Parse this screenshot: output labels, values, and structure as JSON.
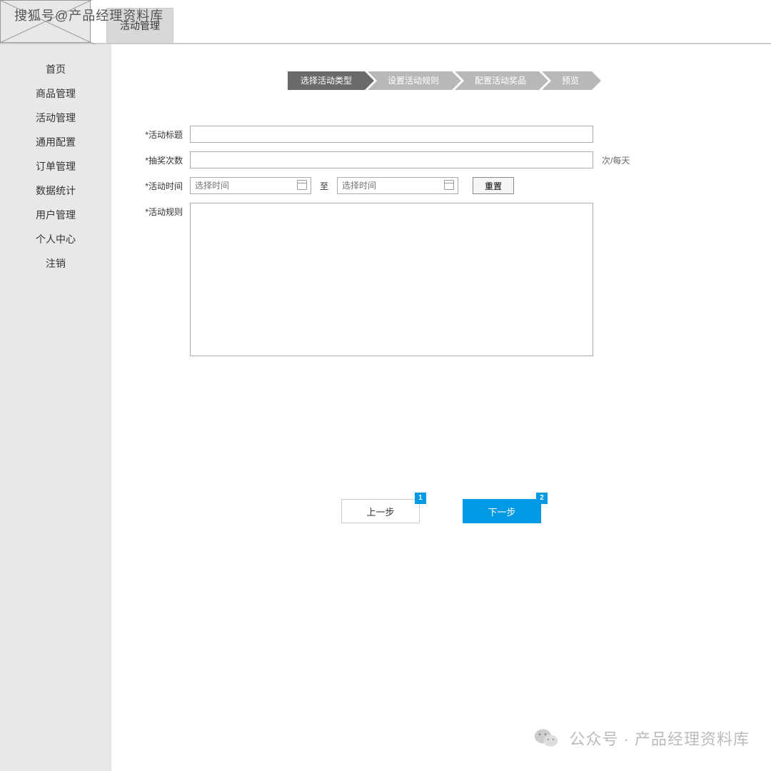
{
  "watermark": {
    "top": "搜狐号@产品经理资料库",
    "bottom": "公众号 · 产品经理资料库"
  },
  "tabs": {
    "active": "活动管理"
  },
  "sidebar": {
    "items": [
      "首页",
      "商品管理",
      "活动管理",
      "通用配置",
      "订单管理",
      "数据统计",
      "用户管理",
      "个人中心",
      "注销"
    ]
  },
  "steps": {
    "items": [
      "选择活动类型",
      "设置活动规则",
      "配置活动奖品",
      "预览"
    ],
    "activeIndex": 0
  },
  "form": {
    "title_label": "*活动标题",
    "title_value": "",
    "count_label": "*抽奖次数",
    "count_value": "",
    "count_suffix": "次/每天",
    "time_label": "*活动时间",
    "time_start_placeholder": "选择时间",
    "time_sep": "至",
    "time_end_placeholder": "选择时间",
    "reset_label": "重置",
    "rules_label": "*活动规则",
    "rules_value": ""
  },
  "actions": {
    "prev_label": "上一步",
    "prev_badge": "1",
    "next_label": "下一步",
    "next_badge": "2"
  }
}
